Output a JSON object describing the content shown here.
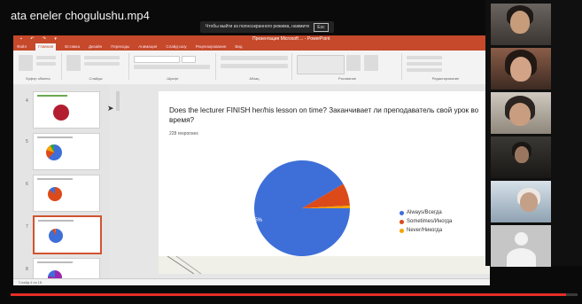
{
  "video": {
    "title": "ata eneler chogulushu.mp4",
    "progress": 0.98
  },
  "fullscreen_notice": {
    "text": "Чтобы выйти из полноэкранного режима, нажмите",
    "key": "Esc"
  },
  "app": {
    "accent": "#c5492a",
    "document_title": "Презентация Microsoft ... - PowerPoint",
    "tabs": [
      "Файл",
      "Главная",
      "Вставка",
      "Дизайн",
      "Переходы",
      "Анимация",
      "Слайд-шоу",
      "Рецензирование",
      "Вид"
    ],
    "active_tab": "Главная",
    "ribbon_groups": [
      "Буфер обмена",
      "Слайды",
      "Шрифт",
      "Абзац",
      "Рисование",
      "Редактирование"
    ],
    "status_text": "Слайд 4 из 18"
  },
  "thumbnails": [
    {
      "number": "4",
      "selected": false,
      "icon": "logo"
    },
    {
      "number": "5",
      "selected": false,
      "icon": "pie-chart"
    },
    {
      "number": "6",
      "selected": false,
      "icon": "pie-chart"
    },
    {
      "number": "7",
      "selected": true,
      "icon": "pie-chart"
    },
    {
      "number": "8",
      "selected": false,
      "icon": "pie-chart"
    }
  ],
  "slide": {
    "title": "Does the lecturer FINISH her/his lesson on time? Заканчивает ли преподаватель свой урок во время?",
    "responses": "228 responses",
    "chart_data": {
      "type": "pie",
      "title": "",
      "labels": [
        "Always/Всегда",
        "Sometimes/Иногда",
        "Never/Никогда"
      ],
      "values": [
        91.5,
        7.6,
        0.9
      ],
      "colors": [
        "#3e6fd8",
        "#dc4a1a",
        "#f5a300"
      ],
      "data_labels": [
        "91.5%",
        "",
        ""
      ]
    }
  },
  "participants": [
    {
      "label": "participant-1"
    },
    {
      "label": "participant-2"
    },
    {
      "label": "participant-3"
    },
    {
      "label": "participant-4"
    },
    {
      "label": "participant-5"
    },
    {
      "label": "participant-6"
    }
  ]
}
